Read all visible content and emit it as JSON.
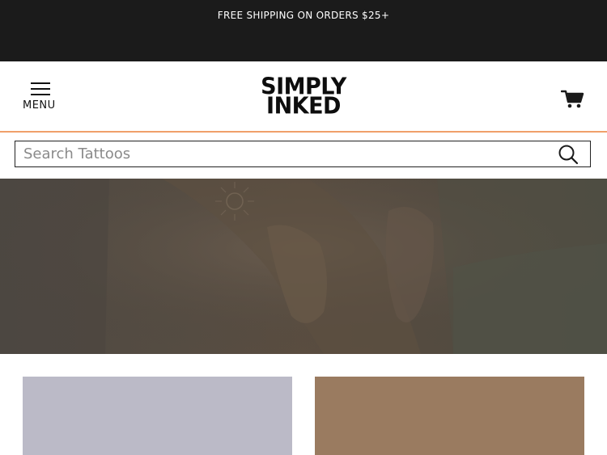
{
  "announcement": {
    "text": "FREE SHIPPING ON ORDERS $25+"
  },
  "header": {
    "menu_label": "MENU",
    "menu_icon": "hamburger-icon",
    "logo_line1": "SIMPLY",
    "logo_line2": "INKED",
    "cart_icon": "cart-icon"
  },
  "search": {
    "placeholder": "Search Tattoos",
    "value": "",
    "icon": "search-icon"
  },
  "hero": {
    "image": "tattooed-arm-photo"
  },
  "tiles": [
    {
      "color": "#bbbac7"
    },
    {
      "color": "#9a7b60"
    }
  ],
  "colors": {
    "announcement_bg": "#1b1b1b",
    "header_border_accent": "#f0a06a"
  }
}
